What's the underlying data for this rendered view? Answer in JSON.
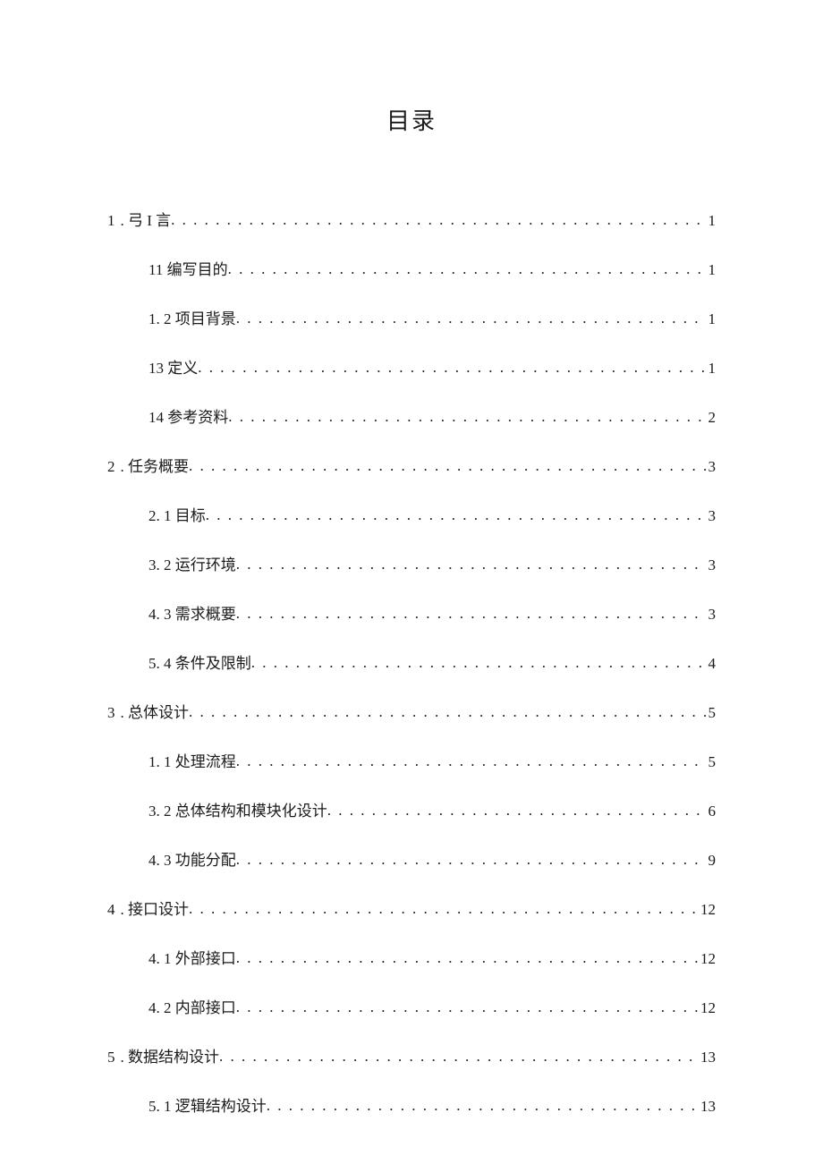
{
  "title": "目录",
  "dots": ". . . . . . . . . . . . . . . . . . . . . . . . . . . . . . . . . . . . . . . . . . . . . . . . . . . . . . . . . . . . . . . . . . . . . . . . . . . . . . . . . . . . . . . . . . . . . . . . . . . . . . . . . . . . . . . . . . . . . . . . . . . . . . . . . . . . . . . . . . . . . . . . . . . . . . . . . . . .",
  "items": [
    {
      "level": 1,
      "num": "1",
      "text": ". 弓 I 言",
      "page": "1"
    },
    {
      "level": 2,
      "num": "",
      "text": "11 编写目的",
      "page": "1"
    },
    {
      "level": 2,
      "num": "",
      "text": "1. 2 项目背景",
      "page": "1"
    },
    {
      "level": 2,
      "num": "",
      "text": "13 定义",
      "page": "1"
    },
    {
      "level": 2,
      "num": "",
      "text": "14 参考资料",
      "page": "2"
    },
    {
      "level": 1,
      "num": "2",
      "text": ". 任务概要",
      "page": "3"
    },
    {
      "level": 2,
      "num": "",
      "text": "2.  1 目标",
      "page": "3"
    },
    {
      "level": 2,
      "num": "",
      "text": "3.  2 运行环境",
      "page": "3"
    },
    {
      "level": 2,
      "num": "",
      "text": "4.  3 需求概要",
      "page": "3"
    },
    {
      "level": 2,
      "num": "",
      "text": "5.  4 条件及限制",
      "page": "4"
    },
    {
      "level": 1,
      "num": "3",
      "text": ". 总体设计",
      "page": "5"
    },
    {
      "level": 2,
      "num": "",
      "text": "1.  1 处理流程",
      "page": "5"
    },
    {
      "level": 2,
      "num": "",
      "text": "3.  2 总体结构和模块化设计",
      "page": "6"
    },
    {
      "level": 2,
      "num": "",
      "text": "4.  3 功能分配",
      "page": "9"
    },
    {
      "level": 1,
      "num": "4",
      "text": ". 接口设计",
      "page": "12"
    },
    {
      "level": 2,
      "num": "",
      "text": "4. 1  外部接口",
      "page": "12"
    },
    {
      "level": 2,
      "num": "",
      "text": "4. 2  内部接口",
      "page": "12"
    },
    {
      "level": 1,
      "num": "5",
      "text": ". 数据结构设计",
      "page": "13"
    },
    {
      "level": 2,
      "num": "",
      "text": "5. 1  逻辑结构设计",
      "page": "13"
    }
  ]
}
